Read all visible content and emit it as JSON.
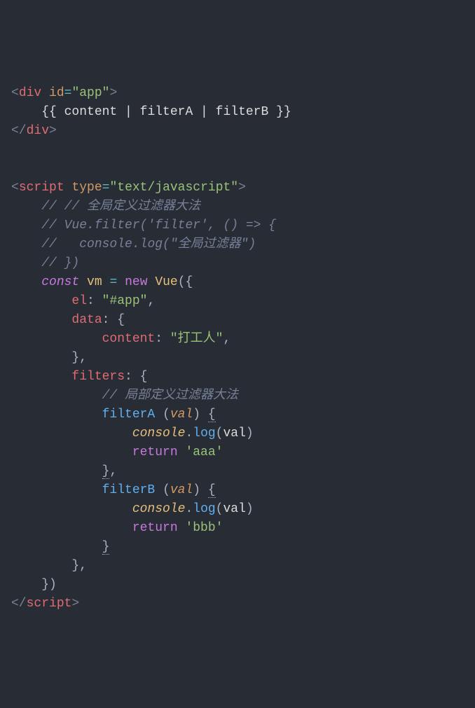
{
  "code": {
    "tag_div": "div",
    "attr_id": "id",
    "val_app": "\"app\"",
    "template_content": "{{ content | filterA | filterB }}",
    "tag_script": "script",
    "attr_type": "type",
    "val_textjs": "\"text/javascript\"",
    "comment1": "// // 全局定义过滤器大法",
    "comment2": "// Vue.filter('filter', () => {",
    "comment3": "//   console.log(\"全局过滤器\")",
    "comment4": "// })",
    "kw_const": "const",
    "var_vm": "vm",
    "op_eq": "=",
    "kw_new": "new",
    "class_vue": "Vue",
    "prop_el": "el",
    "val_elapp": "\"#app\"",
    "prop_data": "data",
    "prop_content": "content",
    "val_content": "\"打工人\"",
    "prop_filters": "filters",
    "comment5": "// 局部定义过滤器大法",
    "fn_filterA": "filterA",
    "param_val": "val",
    "builtin_console": "console",
    "fn_log": "log",
    "arg_val": "val",
    "kw_return": "return",
    "str_aaa": "'aaa'",
    "fn_filterB": "filterB",
    "str_bbb": "'bbb'"
  }
}
